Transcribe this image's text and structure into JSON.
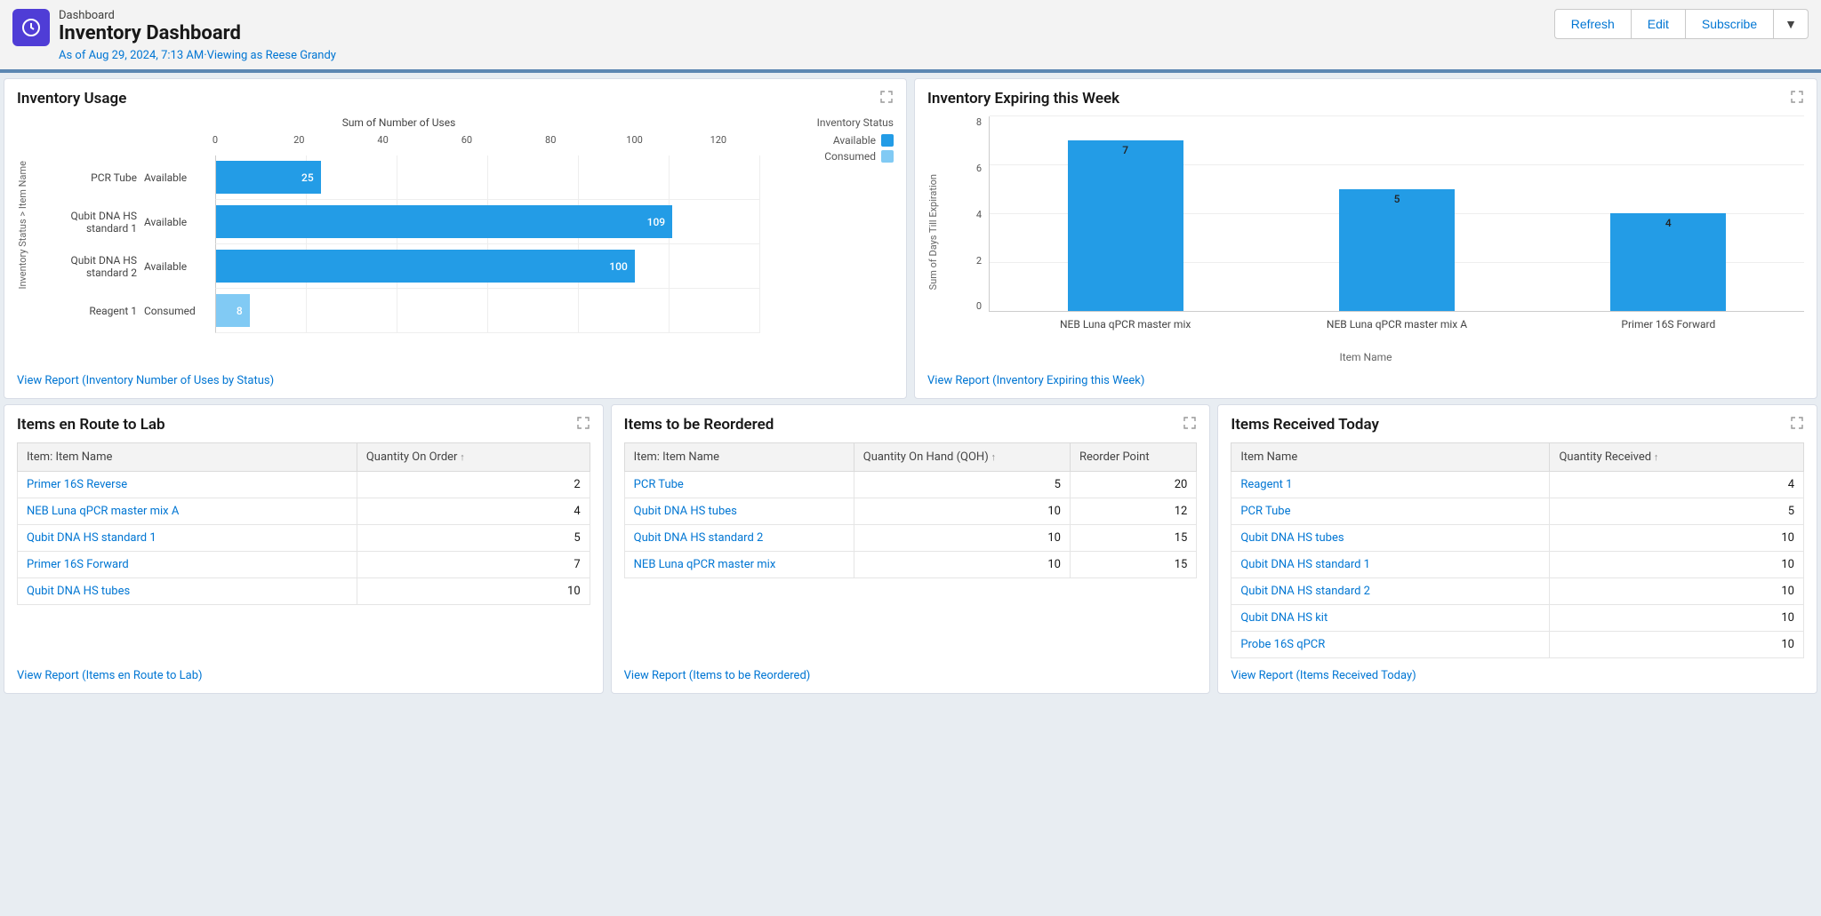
{
  "header": {
    "breadcrumb": "Dashboard",
    "title": "Inventory Dashboard",
    "subline": "As of Aug 29, 2024, 7:13 AM·Viewing as Reese Grandy",
    "buttons": {
      "refresh": "Refresh",
      "edit": "Edit",
      "subscribe": "Subscribe"
    }
  },
  "cards": {
    "usage": {
      "title": "Inventory Usage",
      "xaxis_title": "Sum of Number of Uses",
      "yaxis_title": "Inventory Status > Item Name",
      "legend_title": "Inventory Status",
      "legend": {
        "available": "Available",
        "consumed": "Consumed"
      },
      "report_link": "View Report (Inventory Number of Uses by Status)"
    },
    "expiring": {
      "title": "Inventory Expiring this Week",
      "yaxis_title": "Sum of Days Till Expiration",
      "xaxis_title": "Item Name",
      "report_link": "View Report (Inventory Expiring this Week)"
    },
    "enroute": {
      "title": "Items en Route to Lab",
      "columns": {
        "name": "Item: Item Name",
        "qty": "Quantity On Order"
      },
      "report_link": "View Report (Items en Route to Lab)"
    },
    "reorder": {
      "title": "Items to be Reordered",
      "columns": {
        "name": "Item: Item Name",
        "qoh": "Quantity On Hand (QOH)",
        "point": "Reorder Point"
      },
      "report_link": "View Report (Items to be Reordered)"
    },
    "received": {
      "title": "Items Received Today",
      "columns": {
        "name": "Item Name",
        "qty": "Quantity Received"
      },
      "report_link": "View Report (Items Received Today)"
    }
  },
  "chart_data": [
    {
      "id": "usage",
      "type": "bar",
      "orientation": "horizontal",
      "title": "Inventory Usage",
      "xlabel": "Sum of Number of Uses",
      "ylabel": "Inventory Status > Item Name",
      "xlim": [
        0,
        130
      ],
      "xticks": [
        0,
        20,
        40,
        60,
        80,
        100,
        120
      ],
      "series_field": "Inventory Status",
      "rows": [
        {
          "item": "PCR Tube",
          "status": "Available",
          "value": 25
        },
        {
          "item": "Qubit DNA HS standard 1",
          "status": "Available",
          "value": 109
        },
        {
          "item": "Qubit DNA HS standard 2",
          "status": "Available",
          "value": 100
        },
        {
          "item": "Reagent 1",
          "status": "Consumed",
          "value": 8
        }
      ],
      "colors": {
        "Available": "#239ce6",
        "Consumed": "#81caf4"
      }
    },
    {
      "id": "expiring",
      "type": "bar",
      "orientation": "vertical",
      "title": "Inventory Expiring this Week",
      "xlabel": "Item Name",
      "ylabel": "Sum of Days Till Expiration",
      "ylim": [
        0,
        8
      ],
      "yticks": [
        0,
        2,
        4,
        6,
        8
      ],
      "categories": [
        "NEB Luna qPCR master mix",
        "NEB Luna qPCR master mix A",
        "Primer 16S Forward"
      ],
      "values": [
        7,
        5,
        4
      ],
      "color": "#239ce6"
    }
  ],
  "tables": {
    "enroute": [
      {
        "name": "Primer 16S Reverse",
        "qty": 2
      },
      {
        "name": "NEB Luna qPCR master mix A",
        "qty": 4
      },
      {
        "name": "Qubit DNA HS standard 1",
        "qty": 5
      },
      {
        "name": "Primer 16S Forward",
        "qty": 7
      },
      {
        "name": "Qubit DNA HS tubes",
        "qty": 10
      }
    ],
    "reorder": [
      {
        "name": "PCR Tube",
        "qoh": 5,
        "point": 20
      },
      {
        "name": "Qubit DNA HS tubes",
        "qoh": 10,
        "point": 12
      },
      {
        "name": "Qubit DNA HS standard 2",
        "qoh": 10,
        "point": 15
      },
      {
        "name": "NEB Luna qPCR master mix",
        "qoh": 10,
        "point": 15
      }
    ],
    "received": [
      {
        "name": "Reagent 1",
        "qty": 4
      },
      {
        "name": "PCR Tube",
        "qty": 5
      },
      {
        "name": "Qubit DNA HS tubes",
        "qty": 10
      },
      {
        "name": "Qubit DNA HS standard 1",
        "qty": 10
      },
      {
        "name": "Qubit DNA HS standard 2",
        "qty": 10
      },
      {
        "name": "Qubit DNA HS kit",
        "qty": 10
      },
      {
        "name": "Probe 16S qPCR",
        "qty": 10
      }
    ]
  }
}
